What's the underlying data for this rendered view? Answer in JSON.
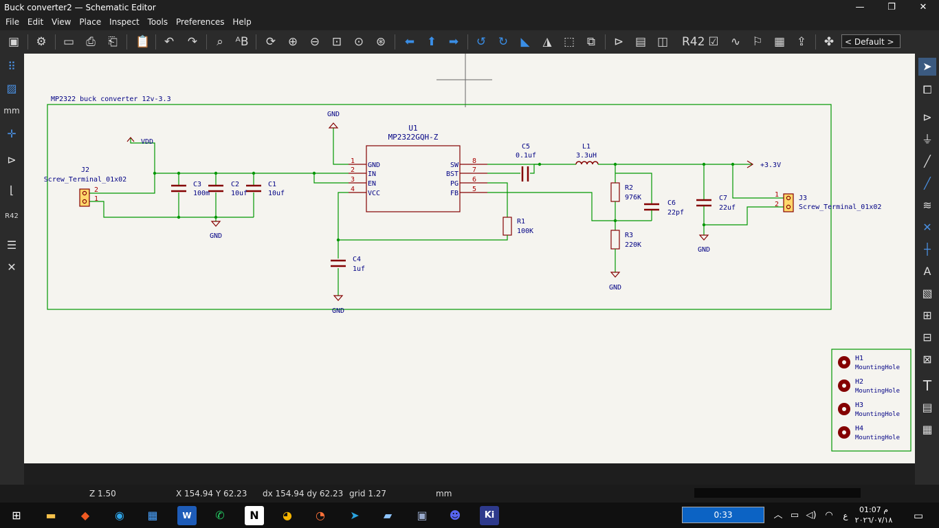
{
  "window": {
    "title": "Buck converter2 — Schematic Editor",
    "minimize": "—",
    "maximize": "❐",
    "close": "✕"
  },
  "menu": [
    "File",
    "Edit",
    "View",
    "Place",
    "Inspect",
    "Tools",
    "Preferences",
    "Help"
  ],
  "toolbar": {
    "layout_select": "< Default >"
  },
  "schematic": {
    "sheet_title": "MP2322 buck converter 12v-3.3",
    "u1": {
      "ref": "U1",
      "value": "MP2322GQH-Z",
      "pins_left": [
        "GND",
        "IN",
        "EN",
        "VCC"
      ],
      "pins_left_num": [
        "1",
        "2",
        "3",
        "4"
      ],
      "pins_right": [
        "SW",
        "BST",
        "PG",
        "FB"
      ],
      "pins_right_num": [
        "8",
        "7",
        "6",
        "5"
      ]
    },
    "j2": {
      "ref": "J2",
      "value": "Screw_Terminal_01x02",
      "pin_a": "2",
      "pin_b": "1"
    },
    "j3": {
      "ref": "J3",
      "value": "Screw_Terminal_01x02",
      "pin_a": "1",
      "pin_b": "2"
    },
    "c1": {
      "ref": "C1",
      "value": "10uf"
    },
    "c2": {
      "ref": "C2",
      "value": "10uf"
    },
    "c3": {
      "ref": "C3",
      "value": "100m"
    },
    "c4": {
      "ref": "C4",
      "value": "1uf"
    },
    "c5": {
      "ref": "C5",
      "value": "0.1uf"
    },
    "c6": {
      "ref": "C6",
      "value": "22pf"
    },
    "c7": {
      "ref": "C7",
      "value": "22uf"
    },
    "l1": {
      "ref": "L1",
      "value": "3.3uH"
    },
    "r1": {
      "ref": "R1",
      "value": "100K"
    },
    "r2": {
      "ref": "R2",
      "value": "976K"
    },
    "r3": {
      "ref": "R3",
      "value": "220K"
    },
    "power": {
      "gnd": "GND",
      "vdd": "VDD",
      "v33": "+3.3V"
    },
    "holes": [
      {
        "ref": "H1",
        "value": "MountingHole"
      },
      {
        "ref": "H2",
        "value": "MountingHole"
      },
      {
        "ref": "H3",
        "value": "MountingHole"
      },
      {
        "ref": "H4",
        "value": "MountingHole"
      }
    ],
    "colors": {
      "wire": "#009600",
      "symbol": "#840000",
      "text": "#000084",
      "pin_num": "#a90000",
      "border": "#009600"
    }
  },
  "status": {
    "zoom": "Z 1.50",
    "coords": "X 154.94  Y 62.23",
    "delta": "dx 154.94  dy 62.23",
    "grid": "grid 1.27",
    "units": "mm"
  },
  "left_toolbar": {
    "units_label": "mm"
  },
  "taskbar": {
    "media_time": "0:33",
    "time": "01:07 م",
    "date": "٢٠٢٦/٠٧/١٨",
    "lang": "ع"
  }
}
